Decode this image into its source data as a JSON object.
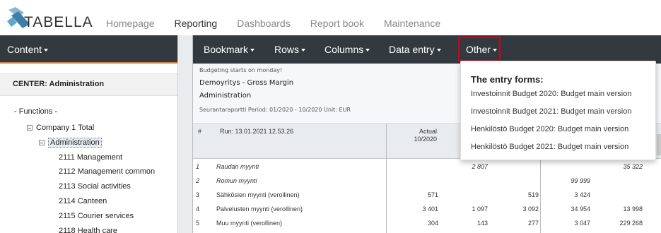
{
  "app": {
    "logo_text": "TABELLA",
    "accent_color": "#e07a2a",
    "toolbar_bg": "#333a3f",
    "highlight_color": "#d0021b"
  },
  "topnav": [
    "Homepage",
    "Reporting",
    "Dashboards",
    "Report book",
    "Maintenance"
  ],
  "left": {
    "menu_label": "Content",
    "center_label": "CENTER: Administration",
    "functions_label": "- Functions -",
    "company_label": "Company 1 Total",
    "selected_label": "Administration",
    "items": [
      "2111 Management",
      "2112 Management common",
      "2113 Social activities",
      "2114 Canteen",
      "2115 Courier services",
      "2118 Health care"
    ]
  },
  "toolbar": {
    "bookmark": "Bookmark",
    "rows": "Rows",
    "columns": "Columns",
    "data_entry": "Data entry",
    "other": "Other"
  },
  "report": {
    "notice": "Budgeting starts on monday!",
    "title": "Demoyritys - Gross Margin",
    "unit_name": "Administration",
    "period": "Seurantaraportti Period: 01/2020 - 10/2020 Unit: EUR",
    "hash": "#",
    "run": "Run: 13.01.2021 12.53.26",
    "col_actual": "Actual",
    "col_actual_period": "10/2020",
    "rows": [
      {
        "n": "1",
        "name": "Raudan myynti",
        "italic": true,
        "v": [
          "",
          "2 807",
          "",
          "",
          "35 322"
        ]
      },
      {
        "n": "2",
        "name": "Romun myynti",
        "italic": true,
        "v": [
          "",
          "",
          "",
          "99 999",
          ""
        ]
      },
      {
        "n": "3",
        "name": "Sähkösien myynti (verollinen)",
        "italic": false,
        "v": [
          "571",
          "",
          "519",
          "3 424",
          ""
        ]
      },
      {
        "n": "4",
        "name": "Palvelusten myynti (verollinen)",
        "italic": false,
        "v": [
          "3 401",
          "1 097",
          "3 092",
          "34 954",
          "13 998"
        ]
      },
      {
        "n": "5",
        "name": "Muu myynti (verollinen)",
        "italic": false,
        "v": [
          "304",
          "143",
          "277",
          "3 047",
          "229 268"
        ]
      }
    ]
  },
  "dropdown": {
    "header": "The entry forms:",
    "items": [
      "Investoinnit Budget 2020: Budget main version",
      "Investoinnit Budget 2021: Budget main version",
      "Henkilöstö Budget 2020: Budget main version",
      "Henkilöstö Budget 2021: Budget main version"
    ]
  }
}
